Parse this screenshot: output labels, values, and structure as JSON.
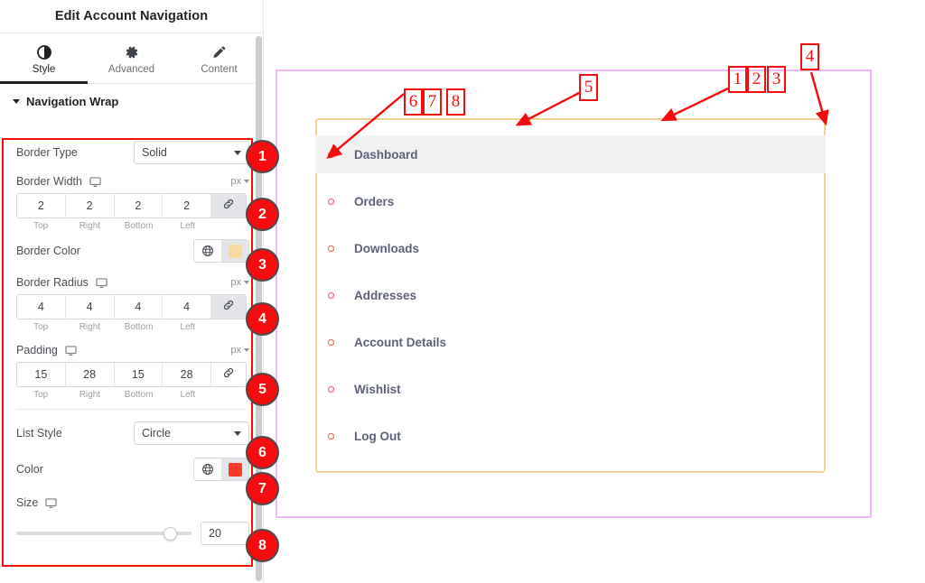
{
  "panel": {
    "title": "Edit Account Navigation",
    "tabs": [
      {
        "label": "Style",
        "icon": "contrast-icon",
        "active": true
      },
      {
        "label": "Advanced",
        "icon": "gear-icon",
        "active": false
      },
      {
        "label": "Content",
        "icon": "pencil-icon",
        "active": false
      }
    ],
    "section": {
      "label": "Navigation Wrap",
      "expanded": true
    },
    "controls": {
      "border_type": {
        "label": "Border Type",
        "value": "Solid"
      },
      "border_width": {
        "label": "Border Width",
        "unit": "px",
        "values": [
          "2",
          "2",
          "2",
          "2"
        ],
        "sides": [
          "Top",
          "Right",
          "Bottom",
          "Left"
        ],
        "linked": true
      },
      "border_color": {
        "label": "Border Color",
        "swatch": "#f8d9a0"
      },
      "border_radius": {
        "label": "Border Radius",
        "unit": "px",
        "values": [
          "4",
          "4",
          "4",
          "4"
        ],
        "sides": [
          "Top",
          "Right",
          "Bottom",
          "Left"
        ],
        "linked": true
      },
      "padding": {
        "label": "Padding",
        "unit": "px",
        "values": [
          "15",
          "28",
          "15",
          "28"
        ],
        "sides": [
          "Top",
          "Right",
          "Bottom",
          "Left"
        ],
        "linked": true
      },
      "list_style": {
        "label": "List Style",
        "value": "Circle"
      },
      "color": {
        "label": "Color",
        "swatch": "#f83a28"
      },
      "size": {
        "label": "Size",
        "value": "20",
        "percent": 88
      }
    }
  },
  "preview": {
    "nav_items": [
      {
        "label": "Dashboard",
        "current": true
      },
      {
        "label": "Orders",
        "current": false
      },
      {
        "label": "Downloads",
        "current": false
      },
      {
        "label": "Addresses",
        "current": false
      },
      {
        "label": "Account Details",
        "current": false
      },
      {
        "label": "Wishlist",
        "current": false
      },
      {
        "label": "Log Out",
        "current": false
      }
    ],
    "wrap_border_color": "#f5d19a",
    "outer_border_color": "#f1b9f7",
    "bullet_color": "#f8544a",
    "current_bg": "#f1f1f1"
  },
  "annotations": {
    "accent": "#f50c0c",
    "badges": [
      "1",
      "2",
      "3",
      "4",
      "5",
      "6",
      "7",
      "8"
    ],
    "callouts": [
      "1",
      "2",
      "3",
      "4",
      "5",
      "6",
      "7",
      "8"
    ]
  }
}
